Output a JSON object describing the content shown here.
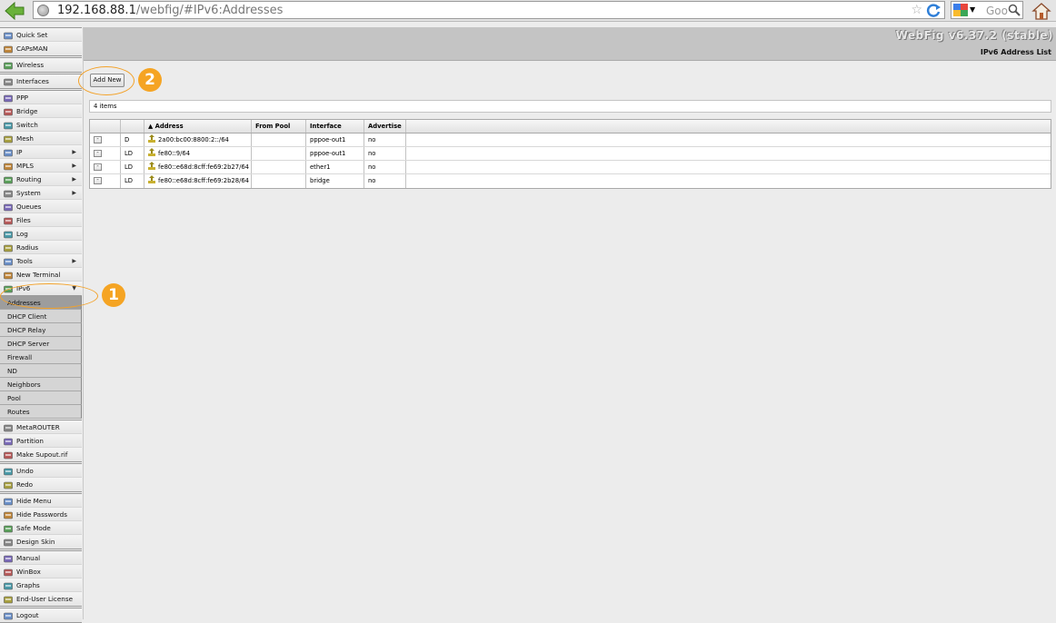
{
  "browser": {
    "url_host": "192.168.88.1",
    "url_path": "/webfig/#IPv6:Addresses",
    "search_placeholder": "Goo"
  },
  "sidebar": {
    "groups": [
      [
        {
          "label": "Quick Set",
          "icon": "quickset-icon"
        },
        {
          "label": "CAPsMAN",
          "icon": "capsman-icon"
        }
      ],
      [
        {
          "label": "Wireless",
          "icon": "wireless-icon"
        }
      ],
      [
        {
          "label": "Interfaces",
          "icon": "interfaces-icon"
        }
      ],
      [
        {
          "label": "PPP",
          "icon": "ppp-icon"
        },
        {
          "label": "Bridge",
          "icon": "bridge-icon"
        },
        {
          "label": "Switch",
          "icon": "switch-icon"
        },
        {
          "label": "Mesh",
          "icon": "mesh-icon"
        },
        {
          "label": "IP",
          "icon": "ip-icon",
          "arrow": "▶"
        },
        {
          "label": "MPLS",
          "icon": "mpls-icon",
          "arrow": "▶"
        },
        {
          "label": "Routing",
          "icon": "routing-icon",
          "arrow": "▶"
        },
        {
          "label": "System",
          "icon": "system-icon",
          "arrow": "▶"
        },
        {
          "label": "Queues",
          "icon": "queues-icon"
        },
        {
          "label": "Files",
          "icon": "files-icon"
        },
        {
          "label": "Log",
          "icon": "log-icon"
        },
        {
          "label": "Radius",
          "icon": "radius-icon"
        },
        {
          "label": "Tools",
          "icon": "tools-icon",
          "arrow": "▶"
        },
        {
          "label": "New Terminal",
          "icon": "terminal-icon"
        },
        {
          "label": "IPv6",
          "icon": "ipv6-icon",
          "arrow": "▼"
        }
      ]
    ],
    "ipv6_submenu": [
      "Addresses",
      "DHCP Client",
      "DHCP Relay",
      "DHCP Server",
      "Firewall",
      "ND",
      "Neighbors",
      "Pool",
      "Routes"
    ],
    "groups_after": [
      [
        {
          "label": "MetaROUTER",
          "icon": "metarouter-icon"
        },
        {
          "label": "Partition",
          "icon": "partition-icon"
        },
        {
          "label": "Make Supout.rif",
          "icon": "supout-icon"
        }
      ],
      [
        {
          "label": "Undo",
          "icon": "undo-icon"
        },
        {
          "label": "Redo",
          "icon": "redo-icon"
        }
      ],
      [
        {
          "label": "Hide Menu",
          "icon": "hide-menu-icon"
        },
        {
          "label": "Hide Passwords",
          "icon": "hide-passwords-icon"
        },
        {
          "label": "Safe Mode",
          "icon": "safe-mode-icon"
        },
        {
          "label": "Design Skin",
          "icon": "design-skin-icon"
        }
      ],
      [
        {
          "label": "Manual",
          "icon": "manual-icon"
        },
        {
          "label": "WinBox",
          "icon": "winbox-icon"
        },
        {
          "label": "Graphs",
          "icon": "graphs-icon"
        },
        {
          "label": "End-User License",
          "icon": "license-icon"
        }
      ],
      [
        {
          "label": "Logout",
          "icon": "logout-icon"
        }
      ]
    ]
  },
  "header": {
    "version": "WebFig v6.37.2 (stable)",
    "title": "IPv6 Address List"
  },
  "toolbar": {
    "add_label": "Add New"
  },
  "annotations": {
    "badge1": "1",
    "badge2": "2"
  },
  "list": {
    "count_label": "4 items",
    "columns": [
      "",
      "",
      "▲ Address",
      "From Pool",
      "Interface",
      "Advertise",
      ""
    ],
    "rows": [
      {
        "flags": "D",
        "address": "2a00:bc00:8800:2::/64",
        "from_pool": "",
        "interface": "pppoe-out1",
        "advertise": "no"
      },
      {
        "flags": "LD",
        "address": "fe80::9/64",
        "from_pool": "",
        "interface": "pppoe-out1",
        "advertise": "no"
      },
      {
        "flags": "LD",
        "address": "fe80::e68d:8cff:fe69:2b27/64",
        "from_pool": "",
        "interface": "ether1",
        "advertise": "no"
      },
      {
        "flags": "LD",
        "address": "fe80::e68d:8cff:fe69:2b28/64",
        "from_pool": "",
        "interface": "bridge",
        "advertise": "no"
      }
    ]
  },
  "colors": {
    "accent_orange": "#f5a423",
    "header_gray": "#c4c4c4",
    "selected_sub": "#9d9d9d"
  }
}
